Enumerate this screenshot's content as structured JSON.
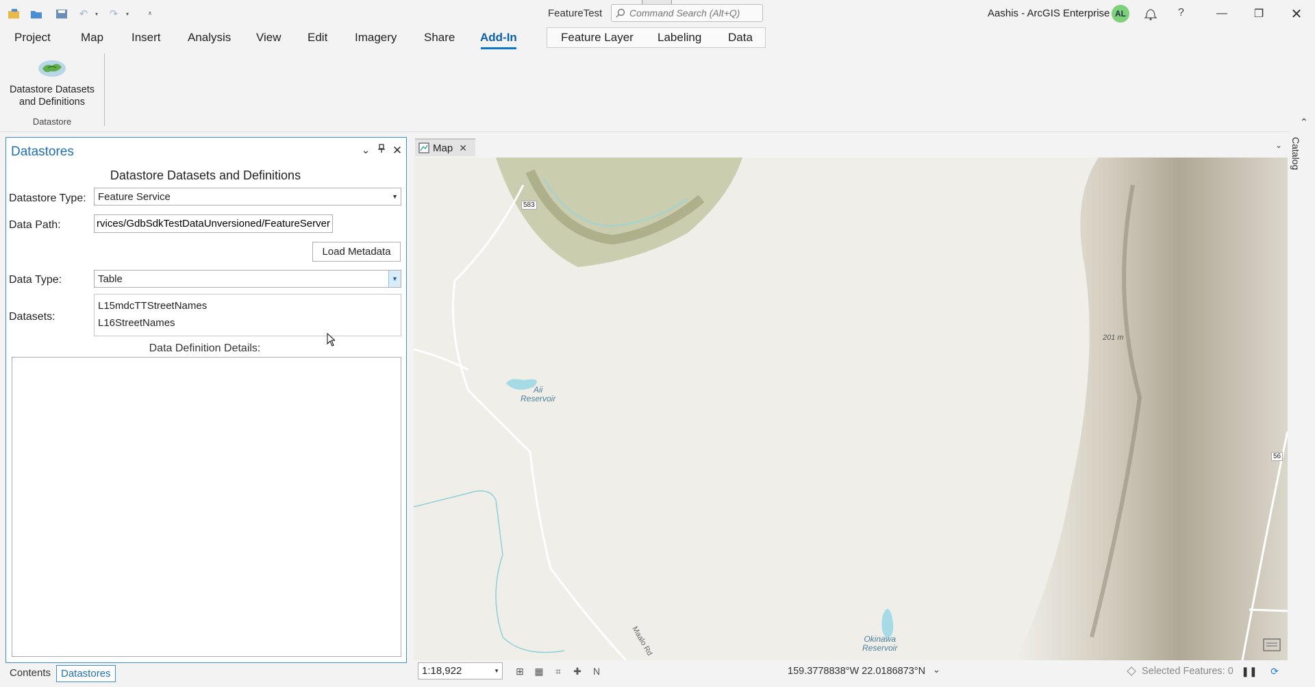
{
  "titlebar": {
    "doc_title": "FeatureTest",
    "search_placeholder": "Command Search (Alt+Q)",
    "user": "Aashis - ArcGIS Enterprise",
    "avatar_initials": "AL"
  },
  "ribbon_tabs": [
    "Project",
    "Map",
    "Insert",
    "Analysis",
    "View",
    "Edit",
    "Imagery",
    "Share",
    "Add-In"
  ],
  "context_tabs": [
    "Feature Layer",
    "Labeling",
    "Data"
  ],
  "ribbon": {
    "button_label_line1": "Datastore Datasets",
    "button_label_line2": "and Definitions",
    "group_label": "Datastore"
  },
  "pane": {
    "title": "Datastores",
    "header": "Datastore Datasets and Definitions",
    "datastore_type_label": "Datastore Type:",
    "datastore_type_value": "Feature Service",
    "data_path_label": "Data Path:",
    "data_path_value": "services/GdbSdkTestDataUnversioned/FeatureServer",
    "load_metadata": "Load Metadata",
    "data_type_label": "Data Type:",
    "data_type_value": "Table",
    "datasets_label": "Datasets:",
    "datasets": [
      "L15mdcTTStreetNames",
      "L16StreetNames"
    ],
    "ddd_label": "Data Definition Details:"
  },
  "bottom_tabs": [
    "Contents",
    "Datastores"
  ],
  "map": {
    "tab_label": "Map",
    "labels": {
      "road_583": "583",
      "road_56": "56",
      "aii_line1": "Aii",
      "aii_line2": "Reservoir",
      "okinawa_line1": "Okinawa",
      "okinawa_line2": "Reservoir",
      "elev": "201 m",
      "maalo": "Maalo Rd"
    },
    "scale": "1:18,922",
    "coordinates": "159.3778838°W 22.0186873°N",
    "selected_features": "Selected Features: 0"
  },
  "catalog_label": "Catalog",
  "colors": {
    "accent": "#1f6fb5",
    "map_bg": "#efeee9",
    "avatar_bg": "#7ed07b"
  }
}
